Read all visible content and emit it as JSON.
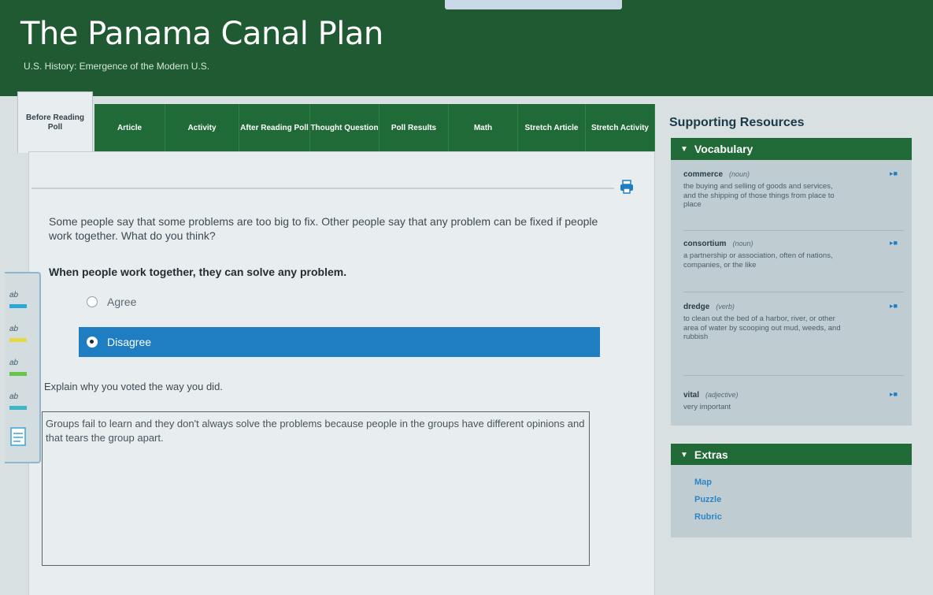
{
  "header": {
    "title": "The Panama Canal Plan",
    "subtitle": "U.S. History: Emergence of the Modern U.S."
  },
  "tabs": [
    {
      "label": "Before Reading Poll",
      "active": true
    },
    {
      "label": "Article",
      "active": false
    },
    {
      "label": "Activity",
      "active": false
    },
    {
      "label": "After Reading Poll",
      "active": false
    },
    {
      "label": "Thought Question",
      "active": false
    },
    {
      "label": "Poll Results",
      "active": false
    },
    {
      "label": "Math",
      "active": false
    },
    {
      "label": "Stretch Article",
      "active": false
    },
    {
      "label": "Stretch Activity",
      "active": false
    }
  ],
  "poll": {
    "question": "Some people say that some problems are too big to fix. Other people say that any problem can be fixed if people work together. What do you think?",
    "statement": "When people work together, they can solve any problem.",
    "options": [
      {
        "label": "Agree",
        "selected": false
      },
      {
        "label": "Disagree",
        "selected": true
      }
    ],
    "explain_label": "Explain why you voted the way you did.",
    "answer": "Groups fail to learn and they don't always solve the problems because people in the groups have different opinions and that tears the group apart."
  },
  "toolbar": {
    "tools": [
      {
        "icon": "highlight-blue-icon",
        "label": "ab",
        "color": "#2fa8d8"
      },
      {
        "icon": "highlight-yellow-icon",
        "label": "ab",
        "color": "#e6d84a"
      },
      {
        "icon": "highlight-green-icon",
        "label": "ab",
        "color": "#6cc34a"
      },
      {
        "icon": "highlight-teal-icon",
        "label": "ab",
        "color": "#3fb6c8"
      },
      {
        "icon": "notes-icon",
        "label": "",
        "color": "#3aa6d6"
      }
    ]
  },
  "sidebar": {
    "heading": "Supporting Resources",
    "vocabulary": {
      "title": "Vocabulary",
      "items": [
        {
          "word": "commerce",
          "pos": "(noun)",
          "definition": "the buying and selling of goods and services, and the shipping of those things from place to place"
        },
        {
          "word": "consortium",
          "pos": "(noun)",
          "definition": "a partnership or association, often of nations, companies, or the like"
        },
        {
          "word": "dredge",
          "pos": "(verb)",
          "definition": "to clean out the bed of a harbor, river, or other area of water by scooping out mud, weeds, and rubbish"
        },
        {
          "word": "vital",
          "pos": "(adjective)",
          "definition": "very important"
        }
      ]
    },
    "extras": {
      "title": "Extras",
      "links": [
        "Map",
        "Puzzle",
        "Rubric"
      ]
    }
  },
  "colors": {
    "header_green": "#1f5a33",
    "tab_green": "#1f6a36",
    "selected_blue": "#1f7ec2",
    "link_blue": "#2a86c8"
  }
}
